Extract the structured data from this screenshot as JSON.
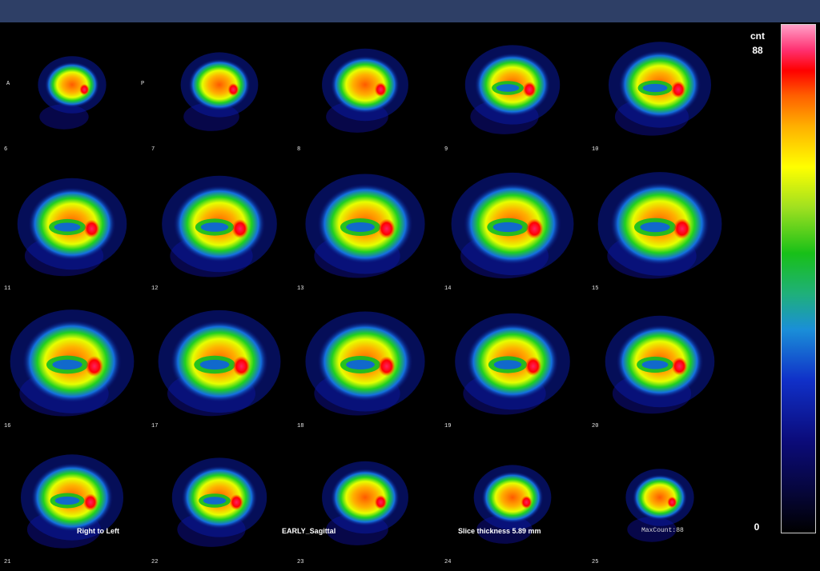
{
  "orientation": {
    "anterior": "A",
    "posterior": "P"
  },
  "slices": [
    {
      "number": "6"
    },
    {
      "number": "7"
    },
    {
      "number": "8"
    },
    {
      "number": "9"
    },
    {
      "number": "10"
    },
    {
      "number": "11"
    },
    {
      "number": "12"
    },
    {
      "number": "13"
    },
    {
      "number": "14"
    },
    {
      "number": "15"
    },
    {
      "number": "16"
    },
    {
      "number": "17"
    },
    {
      "number": "18"
    },
    {
      "number": "19"
    },
    {
      "number": "20"
    },
    {
      "number": "21"
    },
    {
      "number": "22"
    },
    {
      "number": "23"
    },
    {
      "number": "24"
    },
    {
      "number": "25"
    }
  ],
  "footer": {
    "direction": "Right to Left",
    "series": "EARLY_Sagittal",
    "thickness": "Slice thickness 5.89 mm",
    "maxcount": "MaxCount:88"
  },
  "scale": {
    "unit": "cnt",
    "max": "88",
    "min": "0"
  }
}
